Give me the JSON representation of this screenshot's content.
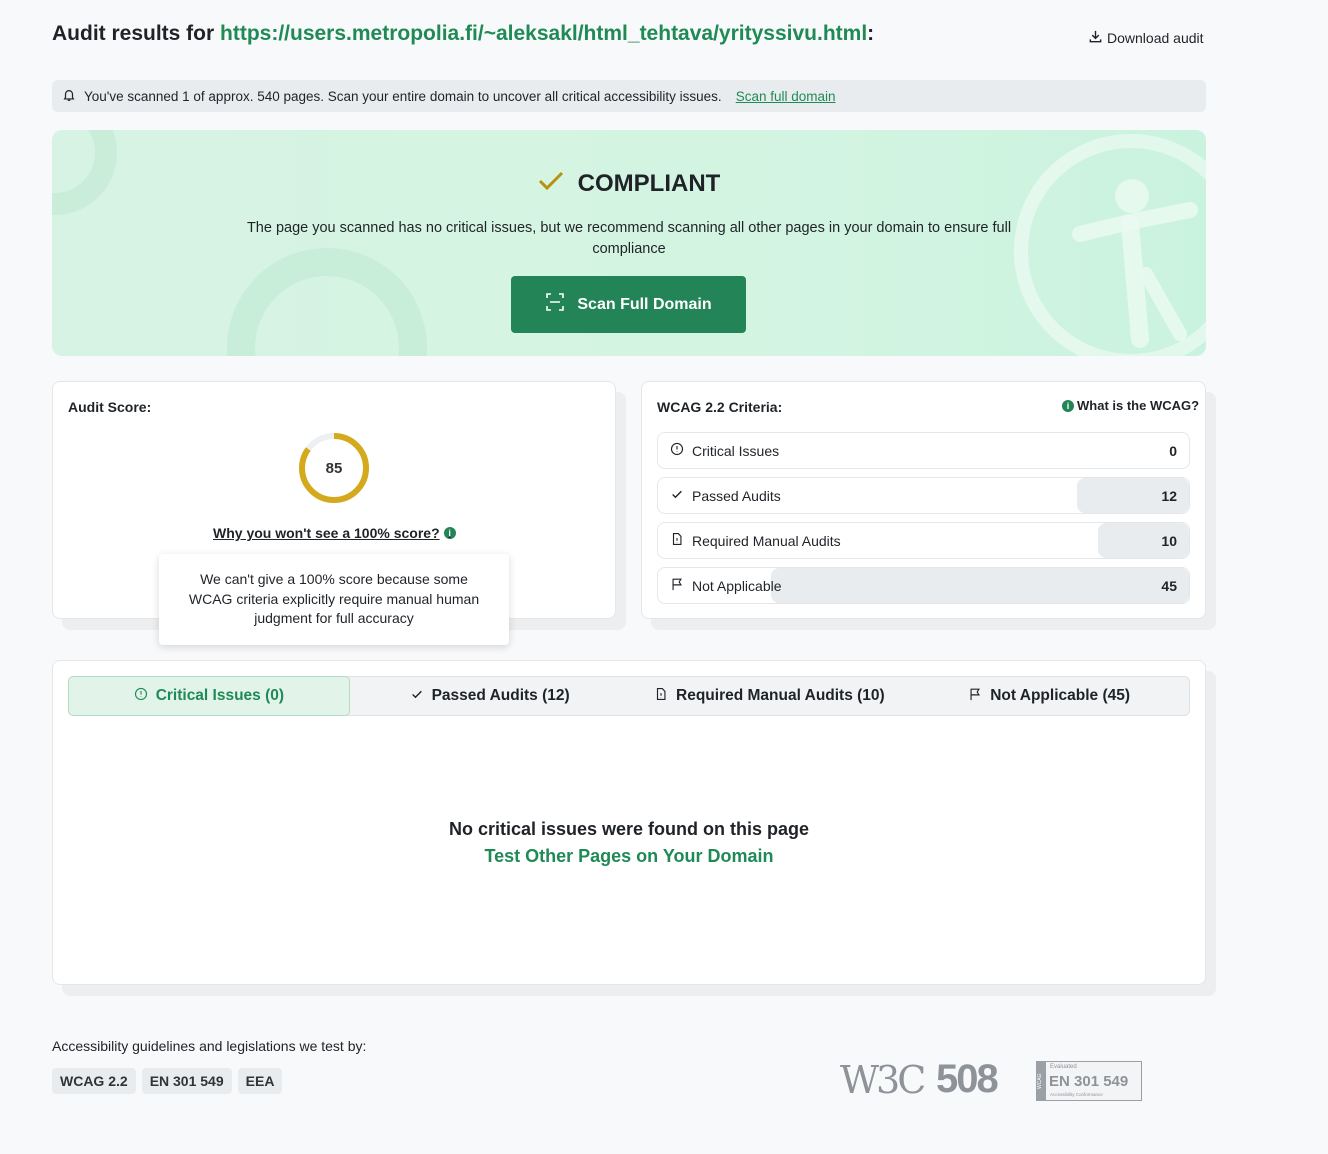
{
  "header": {
    "title_prefix": "Audit results for ",
    "url": "https://users.metropolia.fi/~aleksakl/html_tehtava/yrityssivu.html",
    "title_suffix": ":",
    "download_label": "Download audit"
  },
  "notice": {
    "text": "You've scanned 1 of approx. 540 pages. Scan your entire domain to uncover all critical accessibility issues.",
    "link": "Scan full domain"
  },
  "banner": {
    "status": "COMPLIANT",
    "text": "The page you scanned has no critical issues, but we recommend scanning all other pages in your domain to ensure full compliance",
    "button_label": "Scan Full Domain",
    "status_color": "#b8920f"
  },
  "score_card": {
    "label": "Audit Score:",
    "score": 85,
    "why_link": "Why you won't see a 100% score?",
    "tooltip": "We can't give a 100% score because some WCAG criteria explicitly require manual human judgment for full accuracy",
    "ring_color": "#d4a91c"
  },
  "wcag_card": {
    "label": "WCAG 2.2 Criteria:",
    "help_link": "What is the WCAG?",
    "rows": [
      {
        "label": "Critical Issues",
        "value": "0",
        "icon": "alert-circle-icon"
      },
      {
        "label": "Passed Audits",
        "value": "12",
        "icon": "check-icon"
      },
      {
        "label": "Required Manual Audits",
        "value": "10",
        "icon": "document-icon"
      },
      {
        "label": "Not Applicable",
        "value": "45",
        "icon": "flag-icon"
      }
    ]
  },
  "tabs": [
    {
      "label": "Critical Issues (0)",
      "icon": "alert-circle-icon",
      "active": true
    },
    {
      "label": "Passed Audits (12)",
      "icon": "check-icon",
      "active": false
    },
    {
      "label": "Required Manual Audits (10)",
      "icon": "document-icon",
      "active": false
    },
    {
      "label": "Not Applicable (45)",
      "icon": "flag-icon",
      "active": false
    }
  ],
  "empty_state": {
    "title": "No critical issues were found on this page",
    "link": "Test Other Pages on Your Domain"
  },
  "footer": {
    "label": "Accessibility guidelines and legislations we test by:",
    "badges": [
      "WCAG 2.2",
      "EN 301 549",
      "EEA"
    ],
    "logos": {
      "w3c": "W3C",
      "section508": "508",
      "en_small": "Evaluated",
      "en_main": "EN 301 549",
      "en_sub": "Accessibility Conformance",
      "en_side": "WCAG"
    }
  },
  "colors": {
    "accent": "#238557",
    "accent_text": "#1f8a55"
  }
}
